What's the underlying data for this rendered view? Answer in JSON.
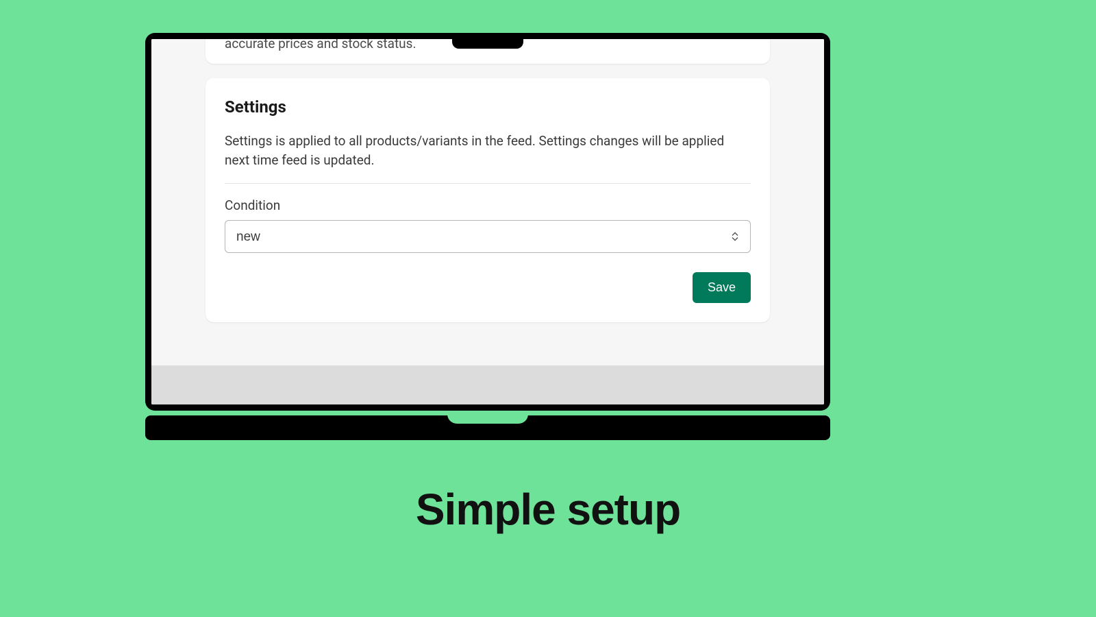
{
  "topCard": {
    "partialText": "accurate prices and stock status."
  },
  "settings": {
    "title": "Settings",
    "description": "Settings is applied to all products/variants in the feed. Settings changes will be applied next time feed is updated.",
    "conditionLabel": "Condition",
    "conditionValue": "new",
    "saveLabel": "Save"
  },
  "tagline": "Simple setup"
}
